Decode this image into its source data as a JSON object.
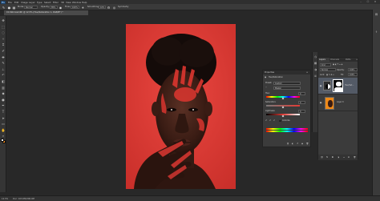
{
  "menubar": {
    "logo": "Ps",
    "items": [
      "File",
      "Edit",
      "Image",
      "Layer",
      "Type",
      "Select",
      "Filter",
      "3D",
      "View",
      "Window",
      "Help"
    ],
    "window_controls": [
      "–",
      "☐",
      "✕"
    ]
  },
  "options_bar": {
    "mode_label": "Mode:",
    "mode_value": "Normal",
    "opacity_label": "Opacity:",
    "opacity_value": "85%",
    "flow_label": "Flow:",
    "flow_value": "100%",
    "smoothing_label": "Smoothing:",
    "smoothing_value": "10%",
    "pressure_label": "Symmetry"
  },
  "document_tab": {
    "title": "CC-Wilcoxsmith @ 12.5% (Hue/Saturation 1, RGB/8*) *",
    "close": "×"
  },
  "status_bar": {
    "zoom": "12.5%",
    "info": "Doc: 103.0M/206.0M"
  },
  "properties": {
    "title": "Properties",
    "adjustment": "Hue/Saturation",
    "preset_label": "Preset:",
    "preset_value": "Custom",
    "channel_value": "Master",
    "hue_label": "Hue:",
    "hue_value": "0",
    "saturation_label": "Saturation:",
    "saturation_value": "0",
    "lightness_label": "Lightness:",
    "lightness_value": "0",
    "colorize_label": "Colorize",
    "colorize_checked": true,
    "hue_position": 0.5,
    "saturation_position": 0.5,
    "lightness_position": 0.5
  },
  "layers": {
    "tabs": [
      "Layers",
      "Channels",
      "Paths"
    ],
    "active_tab": "Layers",
    "kind_label": "Kind",
    "blend_mode": "Normal",
    "opacity_label": "Opacity:",
    "opacity_value": "100%",
    "lock_label": "Lock:",
    "fill_label": "Fill:",
    "fill_value": "100%",
    "rows": [
      {
        "name": "Hue/Sat...",
        "selected": true,
        "visible": true
      },
      {
        "name": "Layer 0",
        "selected": false,
        "visible": true
      }
    ]
  },
  "colors": {
    "foreground": "#ffffff",
    "background": "#f28a1a",
    "photo_background": "#e23b35",
    "selected_layer": "#535a66"
  },
  "tools": [
    "move-icon",
    "marquee-icon",
    "lasso-icon",
    "quick-select-icon",
    "crop-icon",
    "eyedropper-icon",
    "healing-icon",
    "brush-icon",
    "clone-stamp-icon",
    "history-brush-icon",
    "eraser-icon",
    "gradient-icon",
    "blur-icon",
    "dodge-icon",
    "pen-icon",
    "type-icon",
    "path-select-icon",
    "rectangle-icon",
    "hand-icon",
    "zoom-icon"
  ]
}
